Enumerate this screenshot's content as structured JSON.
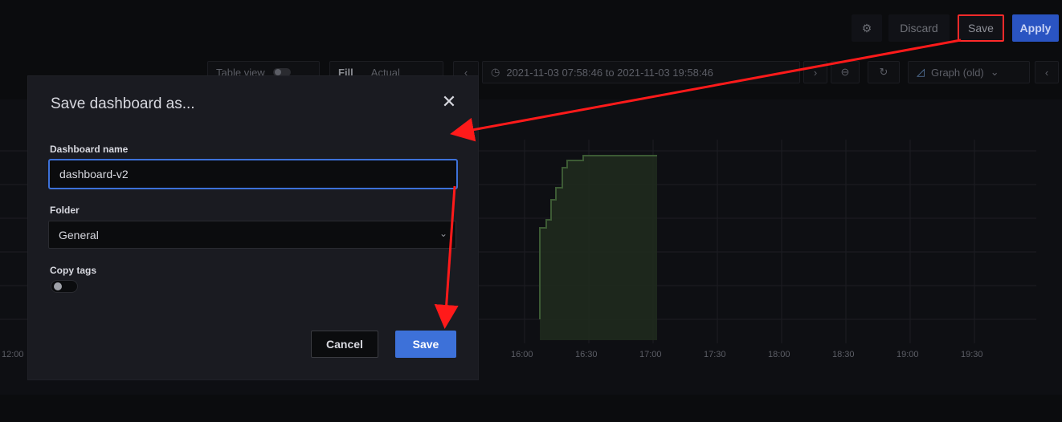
{
  "header": {
    "settings_icon": "gear-icon",
    "discard_label": "Discard",
    "save_label": "Save",
    "apply_label": "Apply"
  },
  "toolbar": {
    "table_view_label": "Table view",
    "fill_label": "Fill",
    "actual_label": "Actual",
    "time_range": "2021-11-03 07:58:46 to 2021-11-03 19:58:46",
    "visualization_label": "Graph (old)"
  },
  "chart": {
    "x_ticks": [
      "12:00",
      "16:00",
      "16:30",
      "17:00",
      "17:30",
      "18:00",
      "18:30",
      "19:00",
      "19:30"
    ],
    "series_color": "#73bf69"
  },
  "dialog": {
    "title": "Save dashboard as...",
    "name_label": "Dashboard name",
    "name_value": "dashboard-v2",
    "folder_label": "Folder",
    "folder_value": "General",
    "copy_tags_label": "Copy tags",
    "copy_tags_on": false,
    "cancel_label": "Cancel",
    "save_label": "Save"
  },
  "colors": {
    "primary": "#3d71d9",
    "annotation": "#ff1a1a"
  }
}
